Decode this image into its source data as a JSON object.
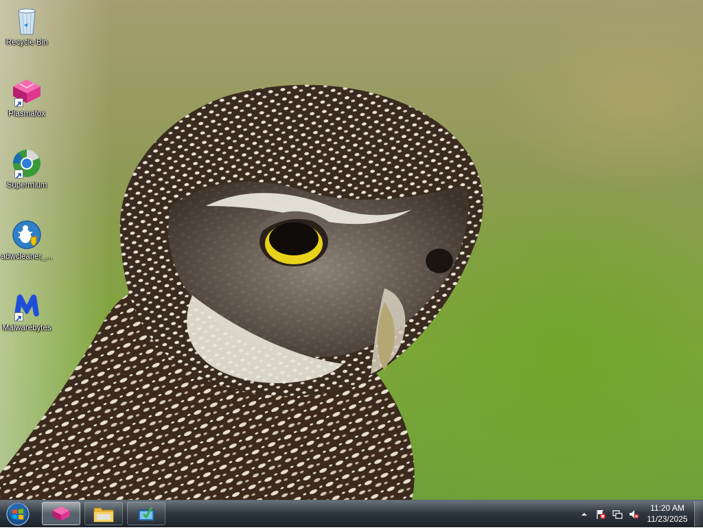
{
  "desktop": {
    "icons": [
      {
        "label": "Recycle Bin",
        "icon": "recycle-bin-icon"
      },
      {
        "label": "Plasmafox",
        "icon": "plasmafox-icon"
      },
      {
        "label": "Supermium",
        "icon": "supermium-icon"
      },
      {
        "label": "adwcleaner_...",
        "icon": "adwcleaner-icon"
      },
      {
        "label": "Malwarebytes",
        "icon": "malwarebytes-icon"
      }
    ]
  },
  "taskbar": {
    "start_icon": "windows-start-orb-icon",
    "pinned": [
      {
        "app": "Plasmafox",
        "icon": "plasmafox-icon",
        "state": "active"
      },
      {
        "app": "Windows Explorer",
        "icon": "folder-icon",
        "state": "normal"
      },
      {
        "app": "Installer",
        "icon": "installer-icon",
        "state": "normal"
      }
    ],
    "tray": {
      "icons": [
        "show-hidden-icons-chevron",
        "action-center-flag-icon",
        "network-icon",
        "volume-muted-icon"
      ],
      "time": "11:20 AM",
      "date": "11/23/2025"
    }
  },
  "colors": {
    "taskbar": "#1a2430",
    "plasmafox_pink": "#e0358f",
    "malwarebytes_blue": "#1e4fd8"
  }
}
